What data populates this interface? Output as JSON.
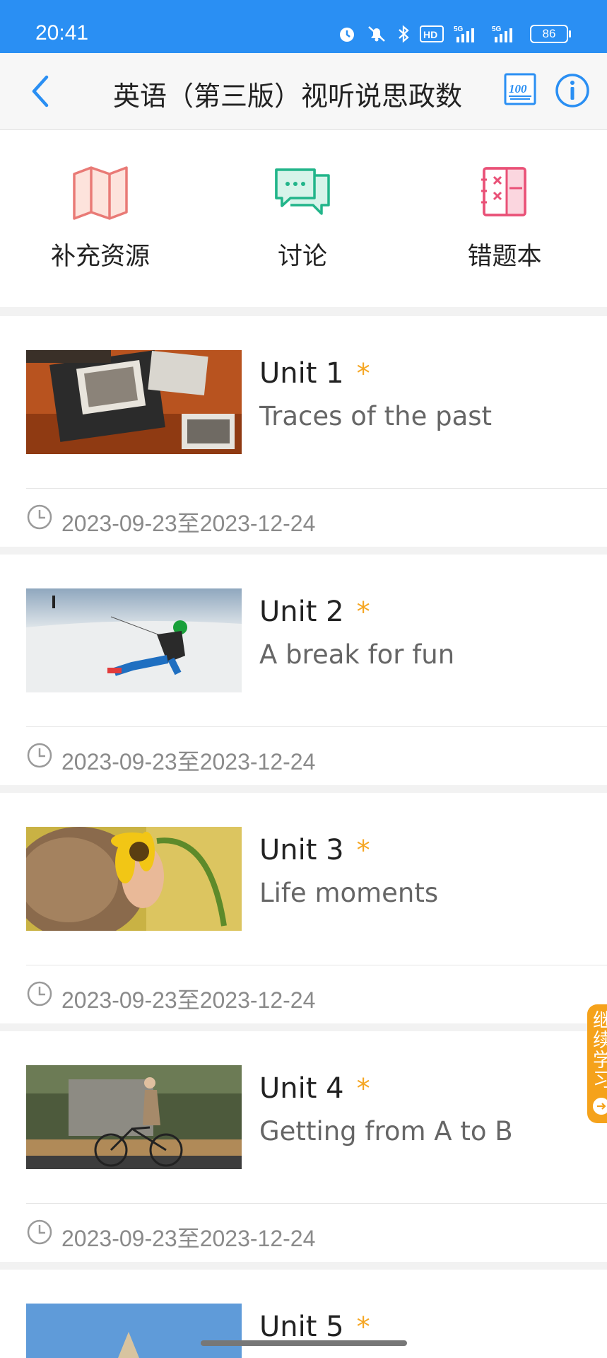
{
  "status_bar": {
    "time": "20:41",
    "battery": "86",
    "icons": [
      "alarm-icon",
      "mute-icon",
      "bluetooth-icon",
      "hd-icon",
      "signal-5g-icon",
      "signal-5g-icon"
    ]
  },
  "header": {
    "title": "英语（第三版）视听说思政数",
    "back_icon": "chevron-left-icon",
    "score_icon": "100-score-icon",
    "info_icon": "info-icon"
  },
  "tools": [
    {
      "label": "补充资源",
      "icon": "map-icon",
      "color": "#e97a76"
    },
    {
      "label": "讨论",
      "icon": "chat-icon",
      "color": "#22b58a"
    },
    {
      "label": "错题本",
      "icon": "notebook-icon",
      "color": "#e95177"
    }
  ],
  "units": [
    {
      "title": "Unit 1",
      "subtitle": "Traces of the  past",
      "date": "2023-09-23至2023-12-24"
    },
    {
      "title": "Unit 2",
      "subtitle": "A break for fun",
      "date": "2023-09-23至2023-12-24"
    },
    {
      "title": "Unit 3",
      "subtitle": "Life moments",
      "date": "2023-09-23至2023-12-24"
    },
    {
      "title": "Unit 4",
      "subtitle": "Getting from A to B",
      "date": "2023-09-23至2023-12-24"
    },
    {
      "title": "Unit 5",
      "subtitle": "",
      "date": ""
    }
  ],
  "star": "*",
  "continue_button": {
    "label": "继续学习"
  },
  "colors": {
    "accent": "#2a8ff3",
    "star": "#f5a623",
    "continue": "#f5a21b"
  }
}
